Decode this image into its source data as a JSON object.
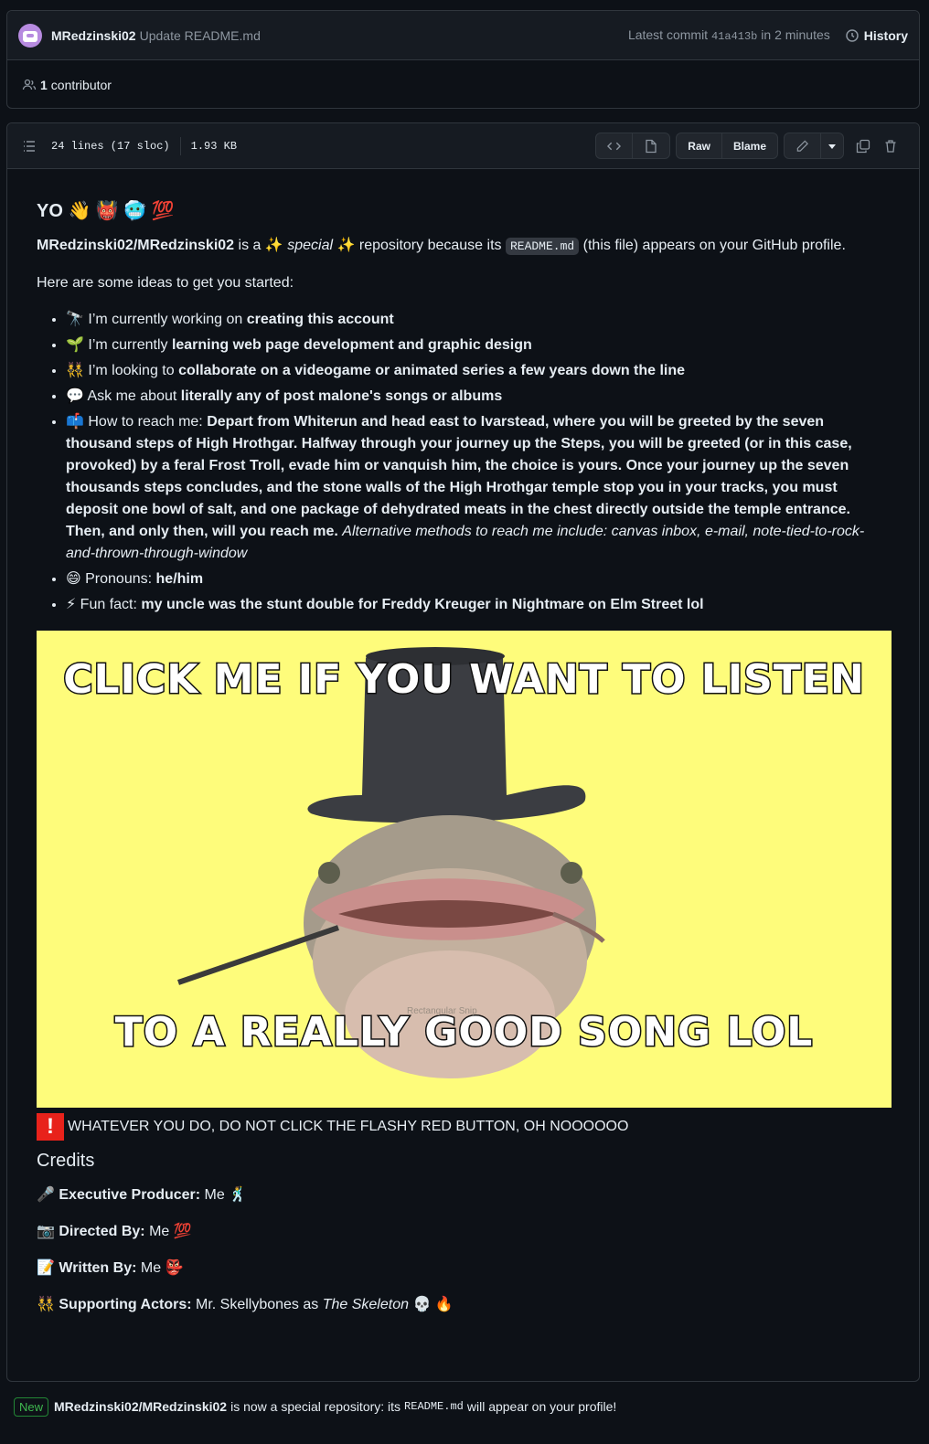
{
  "commit": {
    "author": "MRedzinski02",
    "message": "Update README.md",
    "latest_prefix": "Latest commit",
    "sha": "41a413b",
    "time": "in 2 minutes",
    "history_label": "History"
  },
  "contributors": {
    "count": "1",
    "label": "contributor"
  },
  "file": {
    "lines": "24 lines (17 sloc)",
    "size": "1.93 KB",
    "raw_label": "Raw",
    "blame_label": "Blame"
  },
  "readme": {
    "title": "YO 👋 👹 🥶 💯",
    "intro_repo": "MRedzinski02/MRedzinski02",
    "intro_a": "is a ✨",
    "intro_special": "special",
    "intro_b": "✨ repository because its",
    "intro_code": "README.md",
    "intro_c": "(this file) appears on your GitHub profile.",
    "ideas": "Here are some ideas to get you started:",
    "list": [
      {
        "pre": "🔭 I’m currently working on ",
        "bold": "creating this account"
      },
      {
        "pre": "🌱 I’m currently ",
        "bold": "learning web page development and graphic design"
      },
      {
        "pre": "👯 I’m looking to ",
        "bold": "collaborate on a videogame or animated series a few years down the line"
      },
      {
        "pre": "💬 Ask me about ",
        "bold": "literally any of post malone's songs or albums"
      },
      {
        "pre": "📫 How to reach me: ",
        "bold": "Depart from Whiterun and head east to Ivarstead, where you will be greeted by the seven thousand steps of High Hrothgar. Halfway through your journey up the Steps, you will be greeted (or in this case, provoked) by a feral Frost Troll, evade him or vanquish him, the choice is yours. Once your journey up the seven thousands steps concludes, and the stone walls of the High Hrothgar temple stop you in your tracks, you must deposit one bowl of salt, and one package of dehydrated meats in the chest directly outside the temple entrance. Then, and only then, will you reach me.",
        "italic": "Alternative methods to reach me include: canvas inbox, e-mail, note-tied-to-rock-and-thrown-through-window"
      },
      {
        "pre": "😄 Pronouns: ",
        "bold": "he/him"
      },
      {
        "pre": "⚡ Fun fact: ",
        "bold": "my uncle was the stunt double for Freddy Kreuger in Nightmare on Elm Street lol"
      }
    ],
    "banner_top": "CLICK ME IF YOU WANT TO LISTEN",
    "banner_bottom": "TO A REALLY GOOD SONG LOL",
    "banner_watermark": "Rectangular Snip",
    "warning_icon": "!",
    "warning": "WHATEVER YOU DO, DO NOT CLICK THE FLASHY RED BUTTON, OH NOOOOOO",
    "credits_heading": "Credits",
    "credits": [
      {
        "emoji": "🎤",
        "role": "Executive Producer:",
        "value": " Me 🕺"
      },
      {
        "emoji": "📷",
        "role": "Directed By:",
        "value": " Me 💯"
      },
      {
        "emoji": "📝",
        "role": "Written By:",
        "value": " Me 👺"
      },
      {
        "emoji": "👯",
        "role": "Supporting Actors:",
        "value": " Mr. Skellybones as ",
        "italic": "The Skeleton",
        "tail": " 💀 🔥"
      }
    ]
  },
  "notice": {
    "badge": "New",
    "repo": "MRedzinski02/MRedzinski02",
    "text_a": "is now a special repository: its",
    "code": "README.md",
    "text_b": "will appear on your profile!"
  }
}
